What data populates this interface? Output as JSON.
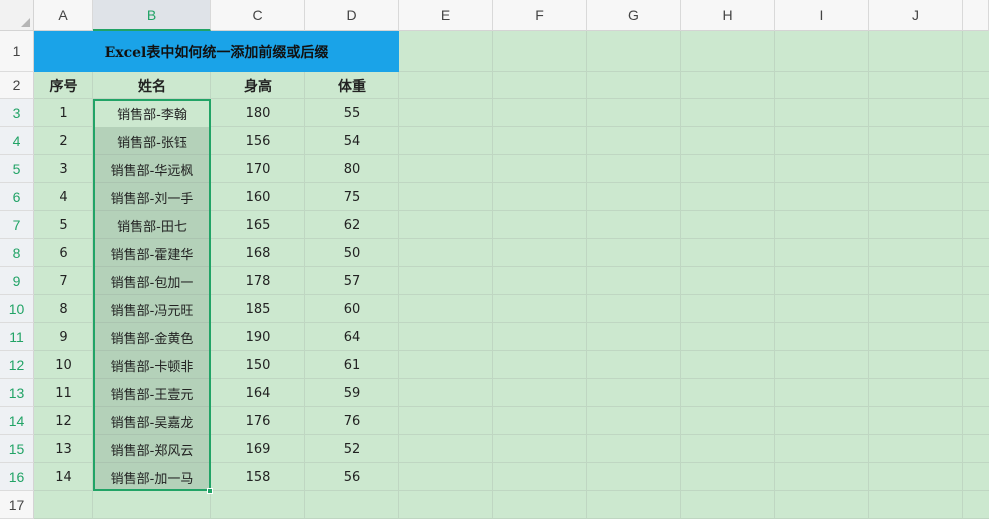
{
  "columns": [
    "A",
    "B",
    "C",
    "D",
    "E",
    "F",
    "G",
    "H",
    "I",
    "J"
  ],
  "selected_column": "B",
  "rows": [
    "1",
    "2",
    "3",
    "4",
    "5",
    "6",
    "7",
    "8",
    "9",
    "10",
    "11",
    "12",
    "13",
    "14",
    "15",
    "16",
    "17"
  ],
  "title": "Excel表中如何统一添加前缀或后缀",
  "headers": {
    "seq": "序号",
    "name": "姓名",
    "height": "身高",
    "weight": "体重"
  },
  "records": [
    {
      "seq": "1",
      "name": "销售部-李翰",
      "height": "180",
      "weight": "55"
    },
    {
      "seq": "2",
      "name": "销售部-张钰",
      "height": "156",
      "weight": "54"
    },
    {
      "seq": "3",
      "name": "销售部-华远枫",
      "height": "170",
      "weight": "80"
    },
    {
      "seq": "4",
      "name": "销售部-刘一手",
      "height": "160",
      "weight": "75"
    },
    {
      "seq": "5",
      "name": "销售部-田七",
      "height": "165",
      "weight": "62"
    },
    {
      "seq": "6",
      "name": "销售部-霍建华",
      "height": "168",
      "weight": "50"
    },
    {
      "seq": "7",
      "name": "销售部-包加一",
      "height": "178",
      "weight": "57"
    },
    {
      "seq": "8",
      "name": "销售部-冯元旺",
      "height": "185",
      "weight": "60"
    },
    {
      "seq": "9",
      "name": "销售部-金黄色",
      "height": "190",
      "weight": "64"
    },
    {
      "seq": "10",
      "name": "销售部-卡顿非",
      "height": "150",
      "weight": "61"
    },
    {
      "seq": "11",
      "name": "销售部-王壹元",
      "height": "164",
      "weight": "59"
    },
    {
      "seq": "12",
      "name": "销售部-吴嘉龙",
      "height": "176",
      "weight": "76"
    },
    {
      "seq": "13",
      "name": "销售部-郑风云",
      "height": "169",
      "weight": "52"
    },
    {
      "seq": "14",
      "name": "销售部-加一马",
      "height": "158",
      "weight": "56"
    }
  ],
  "colors": {
    "sheet_background": "#cce8cf",
    "title_fill": "#1aa3e8",
    "selection_accent": "#21a366"
  }
}
